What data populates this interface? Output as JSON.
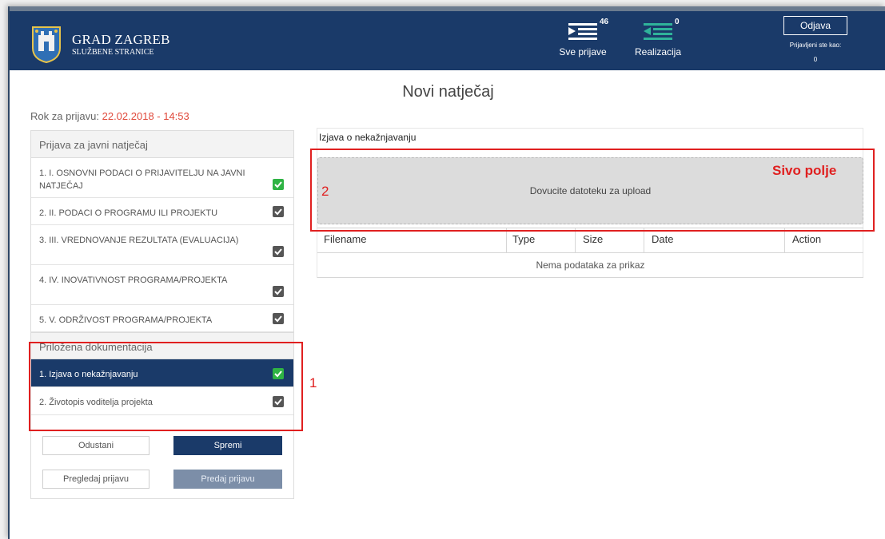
{
  "header": {
    "brand_title": "GRAD ZAGREB",
    "brand_subtitle": "SLUŽBENE STRANICE",
    "nav": [
      {
        "label": "Sve prijave",
        "count": "46",
        "icon": "list-icon"
      },
      {
        "label": "Realizacija",
        "count": "0",
        "icon": "list-icon"
      }
    ],
    "logout_label": "Odjava",
    "logged_in_label": "Prijavljeni ste kao:",
    "logged_in_value": "0",
    "colors": {
      "bar": "#1a3a69"
    }
  },
  "page": {
    "title": "Novi natječaj",
    "deadline_label": "Rok za prijavu:",
    "deadline_value": "22.02.2018 - 14:53"
  },
  "sidebar": {
    "section1_title": "Prijava za javni natječaj",
    "section1_items": [
      {
        "label": "1. I. OSNOVNI PODACI O PRIJAVITELJU NA JAVNI NATJEČAJ",
        "check": "green"
      },
      {
        "label": "2. II. PODACI O PROGRAMU ILI PROJEKTU",
        "check": "gray"
      },
      {
        "label": "3. III. VREDNOVANJE REZULTATA (EVALUACIJA)",
        "check": "gray"
      },
      {
        "label": "4. IV. INOVATIVNOST PROGRAMA/PROJEKTA",
        "check": "gray"
      },
      {
        "label": "5. V. ODRŽIVOST PROGRAMA/PROJEKTA",
        "check": "gray"
      }
    ],
    "section2_title": "Priložena dokumentacija",
    "section2_items": [
      {
        "label": "1. Izjava o nekažnjavanju",
        "check": "green",
        "active": true
      },
      {
        "label": "2. Životopis voditelja projekta",
        "check": "gray",
        "active": false
      }
    ],
    "buttons": {
      "cancel": "Odustani",
      "save": "Spremi",
      "preview": "Pregledaj prijavu",
      "submit": "Predaj prijavu"
    }
  },
  "upload": {
    "title": "Izjava o nekažnjavanju",
    "dropzone_text": "Dovucite datoteku za upload",
    "columns": [
      "Filename",
      "Type",
      "Size",
      "Date",
      "Action"
    ],
    "empty_text": "Nema podataka za prikaz"
  },
  "annotations": {
    "label1": "1",
    "label2": "2",
    "gray_field": "Sivo polje",
    "color": "#e02020"
  }
}
